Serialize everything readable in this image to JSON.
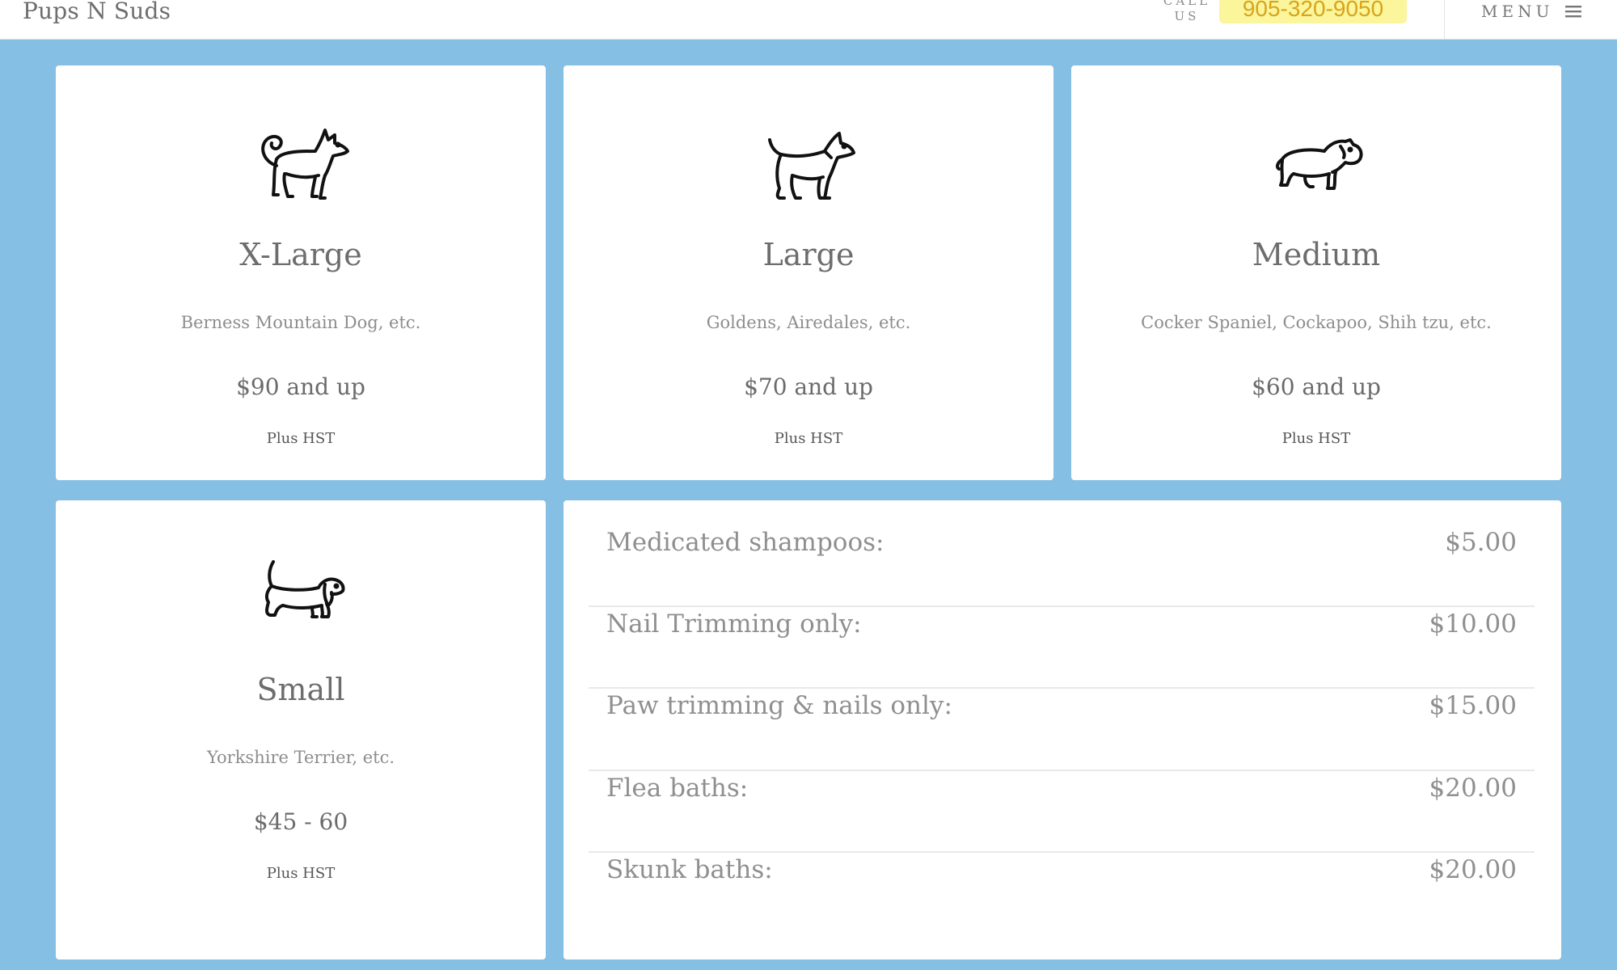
{
  "header": {
    "brand": "Pups N Suds",
    "call_label_line1": "CALL",
    "call_label_line2": "US",
    "phone": "905-320-9050",
    "menu_label": "MENU"
  },
  "sizes": [
    {
      "title": "X-Large",
      "description": "Berness Mountain Dog, etc.",
      "price": "$90 and up",
      "tax": "Plus HST",
      "icon": "husky-dog-icon"
    },
    {
      "title": "Large",
      "description": "Goldens, Airedales, etc.",
      "price": "$70 and up",
      "tax": "Plus HST",
      "icon": "terrier-dog-icon"
    },
    {
      "title": "Medium",
      "description": "Cocker Spaniel, Cockapoo, Shih tzu, etc.",
      "price": "$60 and up",
      "tax": "Plus HST",
      "icon": "bulldog-icon"
    },
    {
      "title": "Small",
      "description": "Yorkshire Terrier, etc.",
      "price": "$45 - 60",
      "tax": "Plus HST",
      "icon": "dachshund-dog-icon"
    }
  ],
  "services": [
    {
      "name": "Medicated shampoos:",
      "price": "$5.00"
    },
    {
      "name": "Nail Trimming only:",
      "price": "$10.00"
    },
    {
      "name": "Paw trimming & nails only:",
      "price": "$15.00"
    },
    {
      "name": "Flea baths:",
      "price": "$20.00"
    },
    {
      "name": "Skunk baths:",
      "price": "$20.00"
    }
  ],
  "colors": {
    "page_background": "#85bfe4",
    "phone_highlight": "#fbf59c",
    "phone_text": "#d9a41a"
  }
}
